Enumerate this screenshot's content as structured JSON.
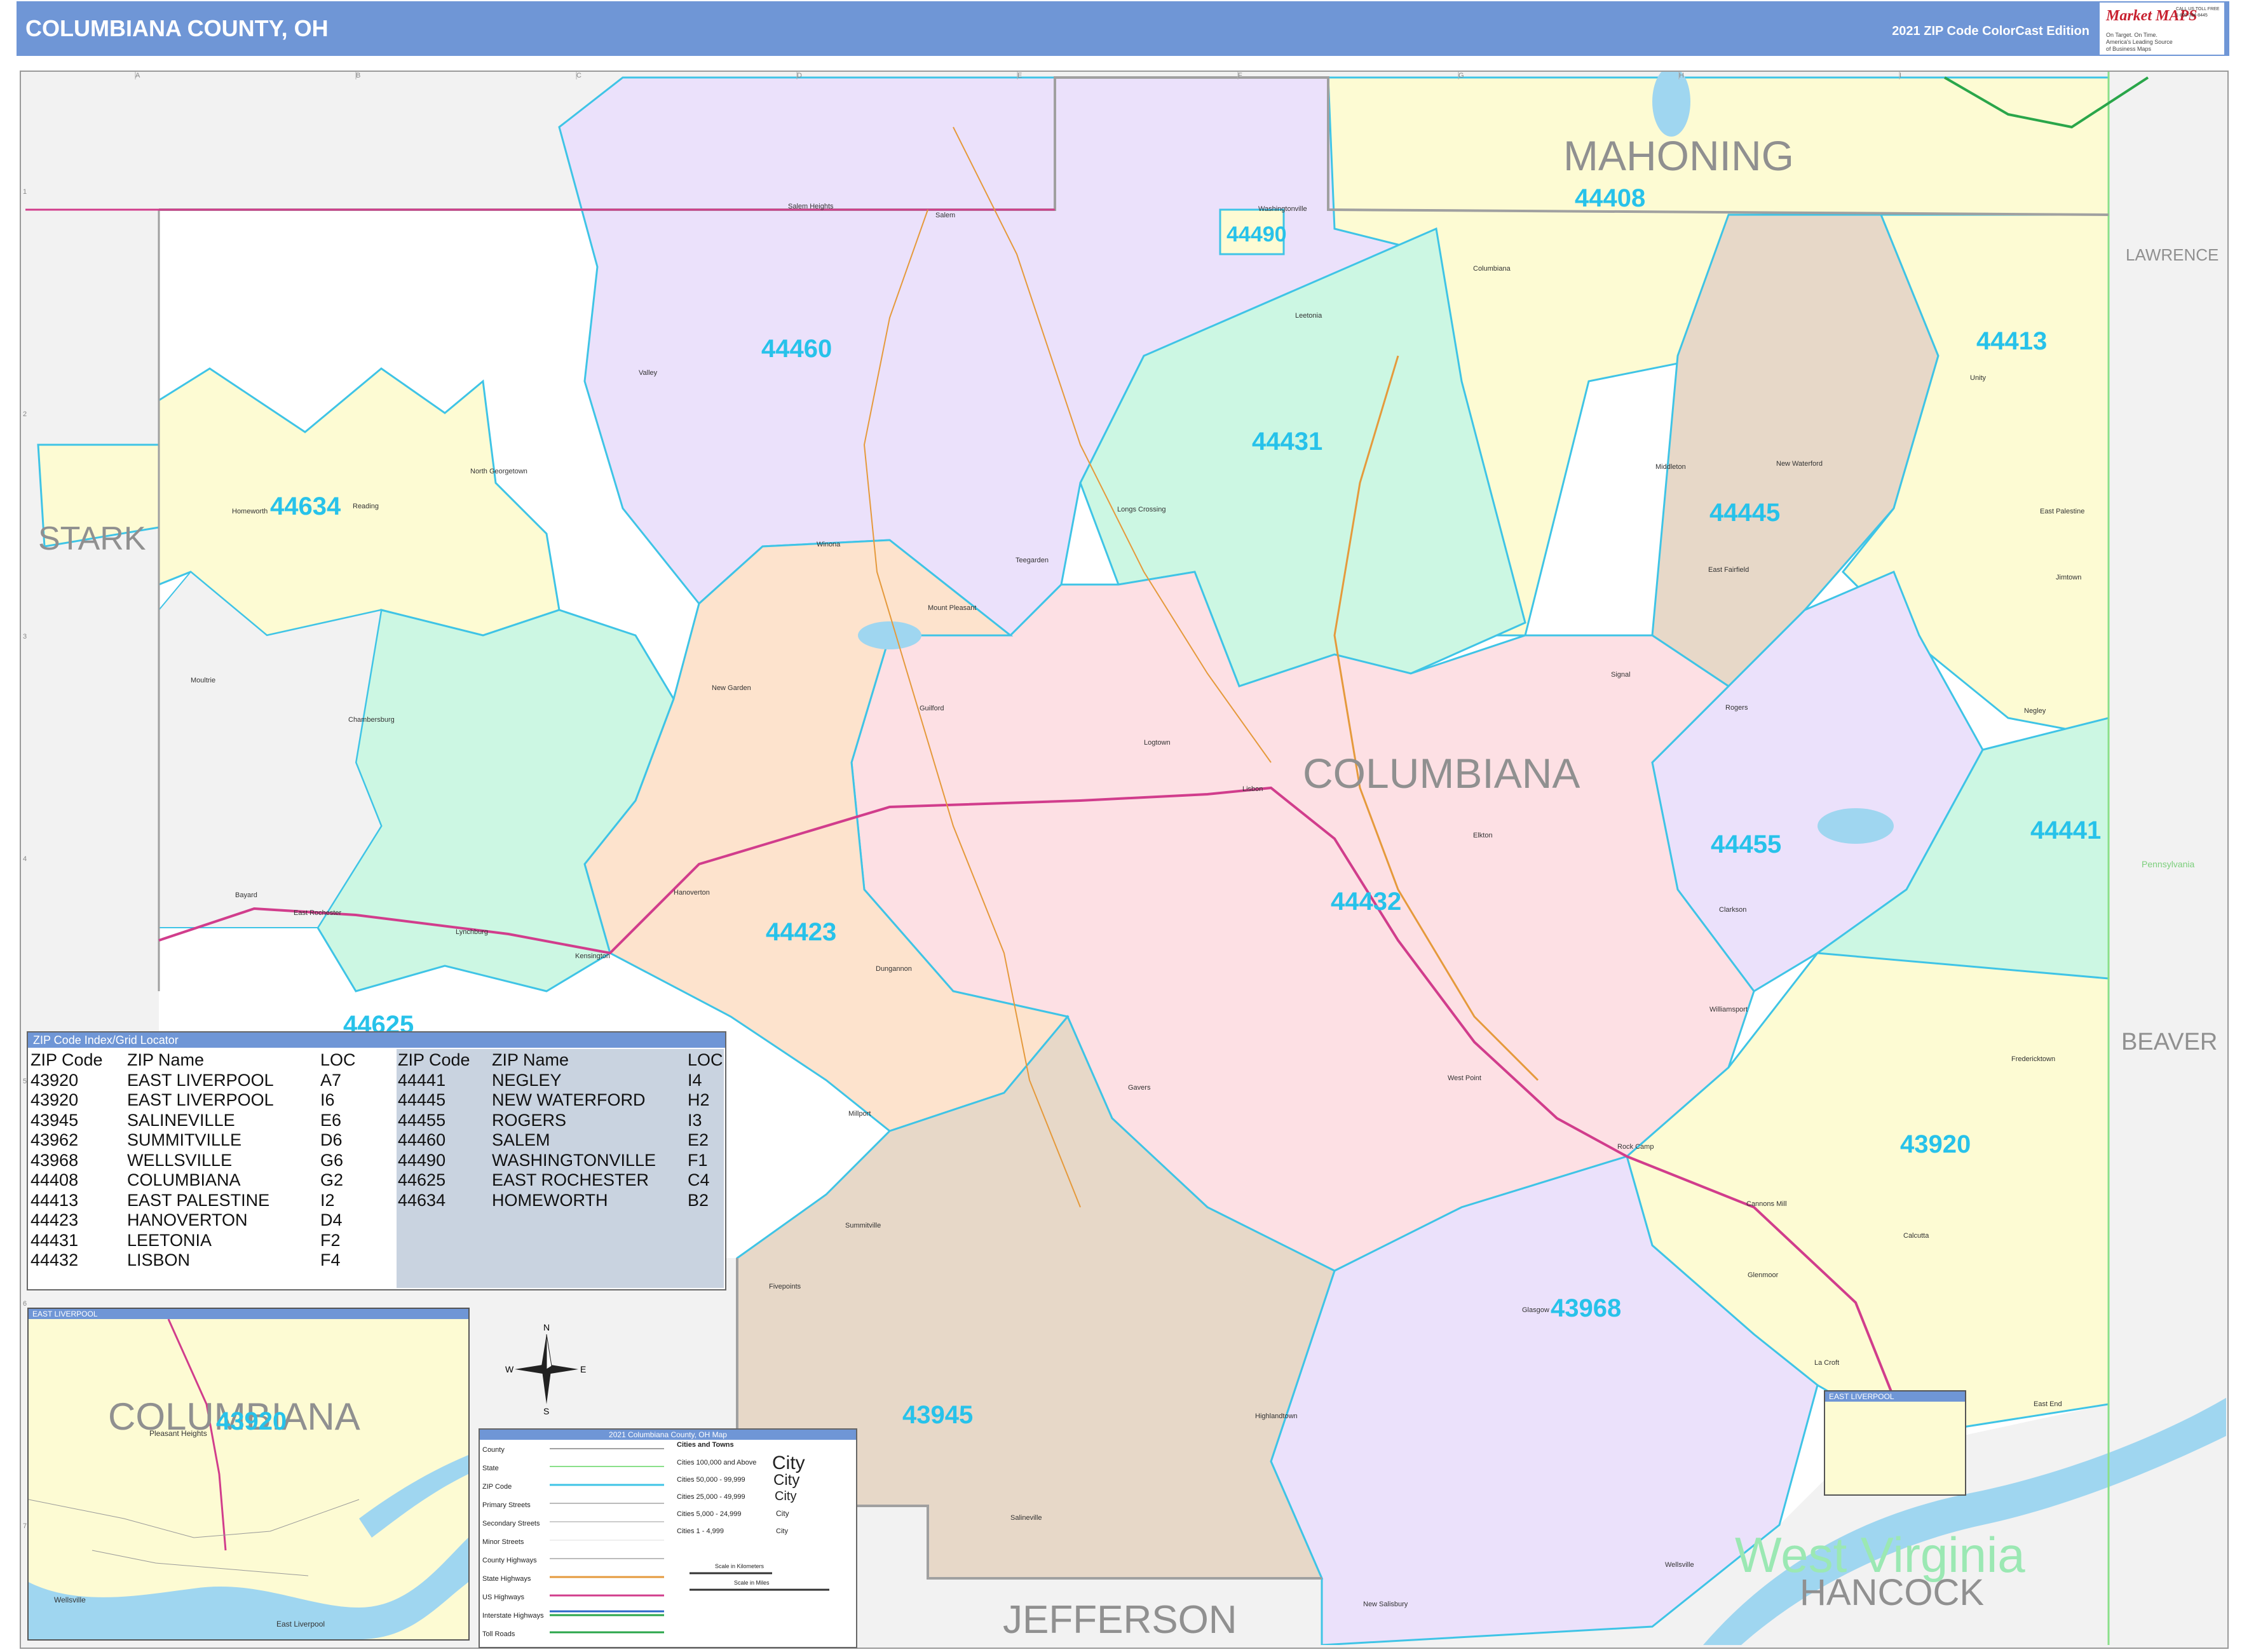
{
  "header": {
    "title": "COLUMBIANA COUNTY, OH",
    "edition": "2021 ZIP Code ColorCast Edition"
  },
  "logo": {
    "brand": "Market MAPS",
    "tagline_1": "On Target. On Time.",
    "tagline_2": "America's Leading Source of Business Maps",
    "contact": "CALL US TOLL FREE 1-800-334-8445"
  },
  "region_labels": {
    "mahoning": "MAHONING",
    "columbiana": "COLUMBIANA",
    "stark": "STARK",
    "lawrence": "LAWRENCE",
    "beaver": "BEAVER",
    "jefferson": "JEFFERSON",
    "hancock": "HANCOCK",
    "west_virginia": "West Virginia",
    "pennsylvania": "Pennsylvania"
  },
  "zip_labels": [
    "44408",
    "44490",
    "44460",
    "44413",
    "44431",
    "44634",
    "44445",
    "44455",
    "44441",
    "44432",
    "44423",
    "44625",
    "43920",
    "43968",
    "43945"
  ],
  "towns": [
    "Salem",
    "Columbiana",
    "Leetonia",
    "Washingtonville",
    "Salem Heights",
    "Homeworth",
    "North Georgetown",
    "Reading",
    "Winona",
    "Teegarden",
    "Longs Crossing",
    "Valley",
    "Middleton",
    "New Waterford",
    "East Palestine",
    "East Fairfield",
    "Unity",
    "Jimtown",
    "Negley",
    "Rogers",
    "Signal",
    "Lisbon",
    "Elkton",
    "Clarkson",
    "Williamsport",
    "West Point",
    "Rock Camp",
    "Fredericktown",
    "Calcutta",
    "Glenmoor",
    "Cannons Mill",
    "Glasgow",
    "La Croft",
    "East End",
    "Wellsville",
    "New Salisbury",
    "Highlandtown",
    "Salineville",
    "Summitville",
    "Fivepoints",
    "Gavers",
    "Dungannon",
    "Hanoverton",
    "Guilford",
    "New Garden",
    "Logtown",
    "Chambersburg",
    "Moultrie",
    "Bayard",
    "East Rochester",
    "Lynchburg",
    "Kensington",
    "Millport",
    "Mount Pleasant"
  ],
  "grid": {
    "columns": [
      "A",
      "B",
      "C",
      "D",
      "E",
      "F",
      "G",
      "H",
      "I"
    ],
    "rows": [
      "1",
      "2",
      "3",
      "4",
      "5",
      "6",
      "7"
    ]
  },
  "index": {
    "title": "ZIP Code Index/Grid Locator",
    "headers": {
      "zip": "ZIP Code",
      "name": "ZIP Name",
      "loc": "LOC"
    },
    "left_rows": [
      {
        "zip": "43920",
        "name": "EAST LIVERPOOL",
        "loc": "A7"
      },
      {
        "zip": "43920",
        "name": "EAST LIVERPOOL",
        "loc": "I6"
      },
      {
        "zip": "43945",
        "name": "SALINEVILLE",
        "loc": "E6"
      },
      {
        "zip": "43962",
        "name": "SUMMITVILLE",
        "loc": "D6"
      },
      {
        "zip": "43968",
        "name": "WELLSVILLE",
        "loc": "G6"
      },
      {
        "zip": "44408",
        "name": "COLUMBIANA",
        "loc": "G2"
      },
      {
        "zip": "44413",
        "name": "EAST PALESTINE",
        "loc": "I2"
      },
      {
        "zip": "44423",
        "name": "HANOVERTON",
        "loc": "D4"
      },
      {
        "zip": "44431",
        "name": "LEETONIA",
        "loc": "F2"
      },
      {
        "zip": "44432",
        "name": "LISBON",
        "loc": "F4"
      }
    ],
    "right_rows": [
      {
        "zip": "44441",
        "name": "NEGLEY",
        "loc": "I4"
      },
      {
        "zip": "44445",
        "name": "NEW WATERFORD",
        "loc": "H2"
      },
      {
        "zip": "44455",
        "name": "ROGERS",
        "loc": "I3"
      },
      {
        "zip": "44460",
        "name": "SALEM",
        "loc": "E2"
      },
      {
        "zip": "44490",
        "name": "WASHINGTONVILLE",
        "loc": "F1"
      },
      {
        "zip": "44625",
        "name": "EAST ROCHESTER",
        "loc": "C4"
      },
      {
        "zip": "44634",
        "name": "HOMEWORTH",
        "loc": "B2"
      }
    ]
  },
  "inset": {
    "title": "EAST LIVERPOOL",
    "county_label": "COLUMBIANA",
    "zip_label": "43920",
    "towns": [
      "Pleasant Heights",
      "East Liverpool",
      "Wellsville"
    ]
  },
  "inset2": {
    "title": "EAST LIVERPOOL"
  },
  "compass": {
    "n": "N",
    "s": "S",
    "e": "E",
    "w": "W"
  },
  "legend": {
    "title": "2021 Columbiana County, OH Map",
    "left_items": [
      "County",
      "State",
      "ZIP Code",
      "Primary Streets",
      "Secondary Streets",
      "Minor Streets",
      "County Highways",
      "State Highways",
      "US Highways",
      "Interstate Highways",
      "Toll Roads"
    ],
    "cities_heading": "Cities and Towns",
    "city_classes": [
      {
        "label": "Cities 100,000 and Above",
        "sample": "City"
      },
      {
        "label": "Cities 50,000 - 99,999",
        "sample": "City"
      },
      {
        "label": "Cities 25,000 - 49,999",
        "sample": "City"
      },
      {
        "label": "Cities 5,000 - 24,999",
        "sample": "City"
      },
      {
        "label": "Cities 1 - 4,999",
        "sample": "City"
      }
    ],
    "scale_km": "Scale in Kilometers",
    "scale_mi": "Scale in Miles"
  },
  "colors": {
    "header_bg": "#6f96d6",
    "zip_label": "#27c2ea",
    "zip_boundary": "#3fc4e6",
    "lavender": "#ebe1fb",
    "mint": "#ccf7e3",
    "yellow": "#fdfbd3",
    "tan": "#e7d8c8",
    "peach": "#fde3cd",
    "pink": "#fde0e4",
    "water": "#9fd6f0",
    "county_label": "#909090"
  }
}
